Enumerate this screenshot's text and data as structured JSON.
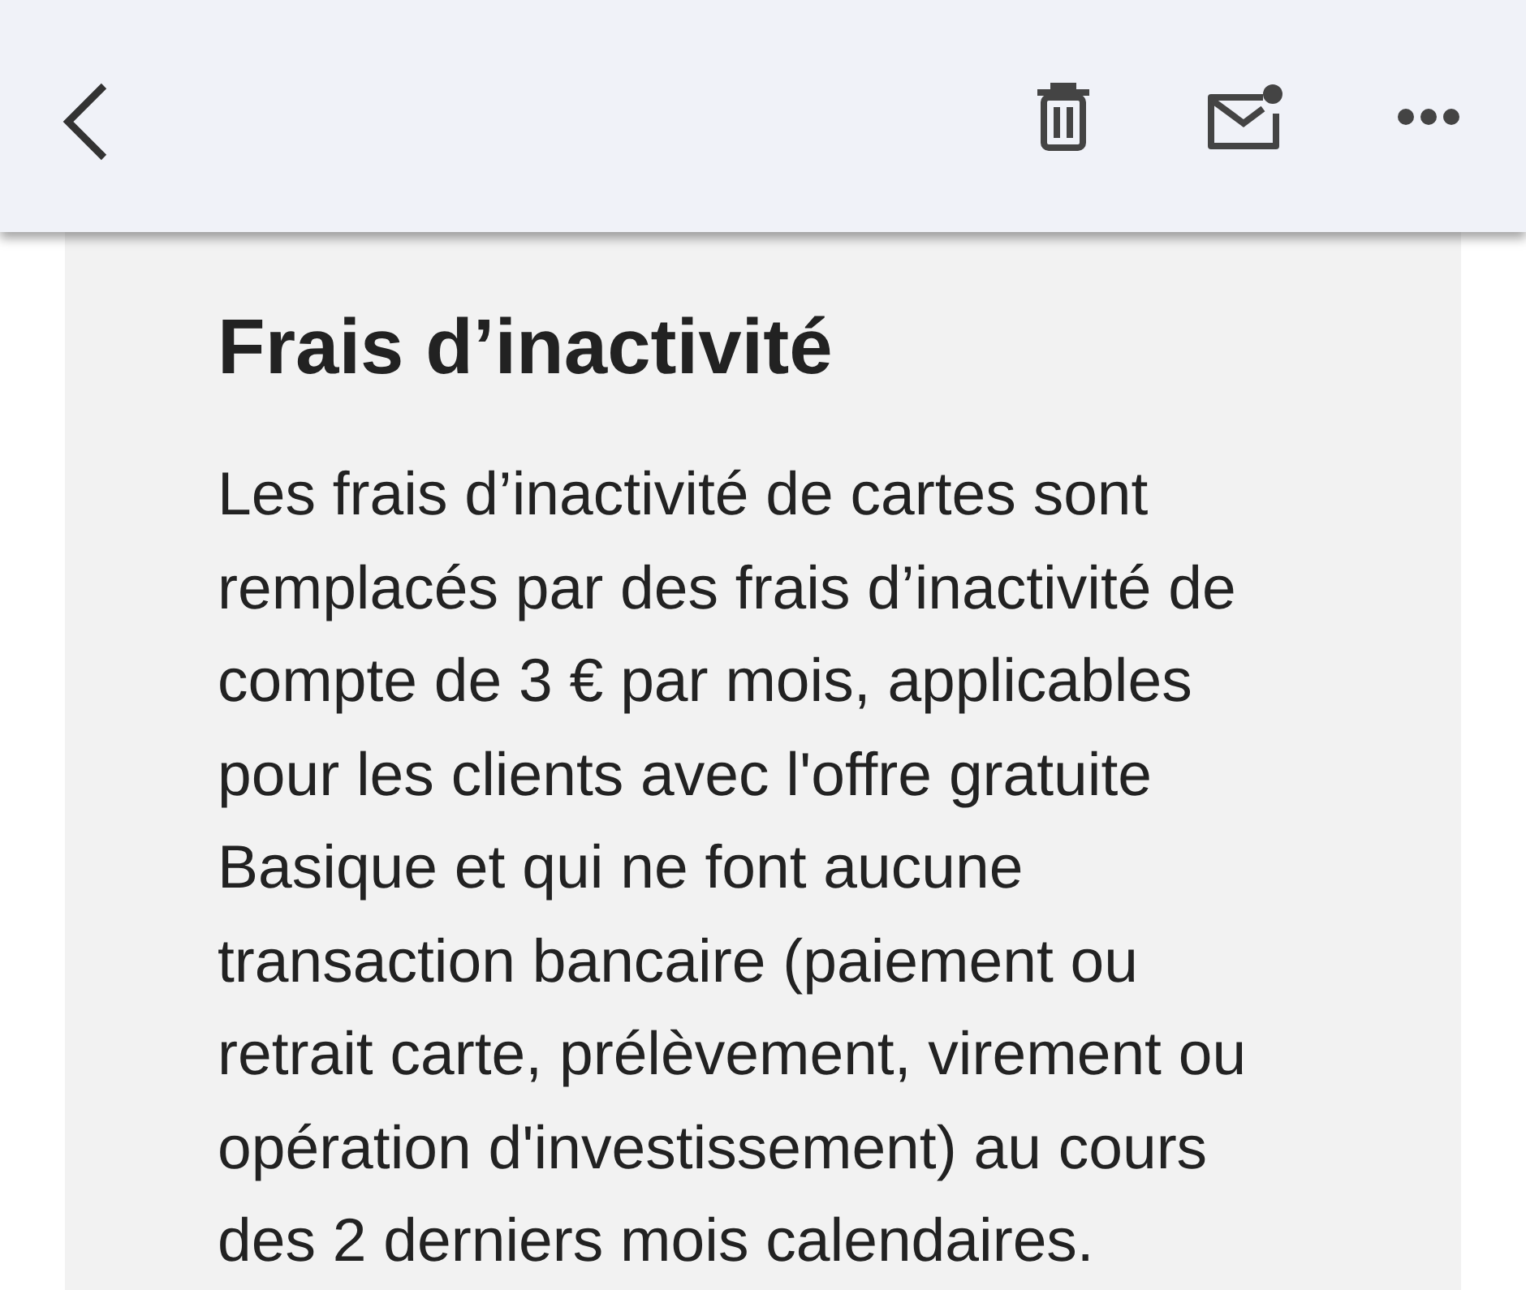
{
  "section": {
    "heading": "Frais d’inactivité",
    "body": "Les frais d’inactivité de cartes sont remplacés par des frais d’inactivité de compte de 3 € par mois, applicables pour les clients avec l'offre gratuite Basique et qui ne font aucune transaction bancaire (paiement ou retrait carte, prélèvement, virement ou opération d'investissement) au cours des 2 derniers mois calendaires."
  }
}
